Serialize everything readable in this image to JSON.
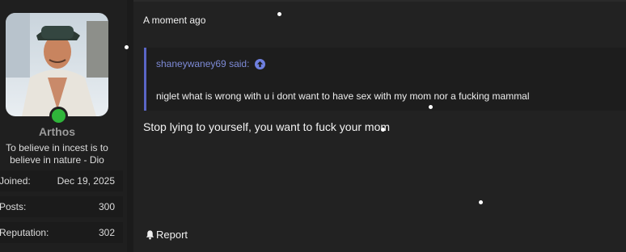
{
  "user": {
    "name": "Arthos",
    "title": "To believe in incest is to believe in nature - Dio",
    "status": "online",
    "status_color": "#2fb53a"
  },
  "stats": [
    {
      "label": "Joined:",
      "value": "Dec 19, 2025"
    },
    {
      "label": "Posts:",
      "value": "300"
    },
    {
      "label": "Reputation:",
      "value": "302"
    }
  ],
  "post": {
    "timestamp": "A moment ago",
    "quote": {
      "author_label": "shaneywaney69 said:",
      "body": "niglet what is wrong with u i dont want to have sex with my mom nor a fucking mammal",
      "accent": "#5a66c6"
    },
    "message": "Stop lying to yourself, you want to fuck your mom",
    "report_label": "Report",
    "report_icon": "bell-icon"
  }
}
